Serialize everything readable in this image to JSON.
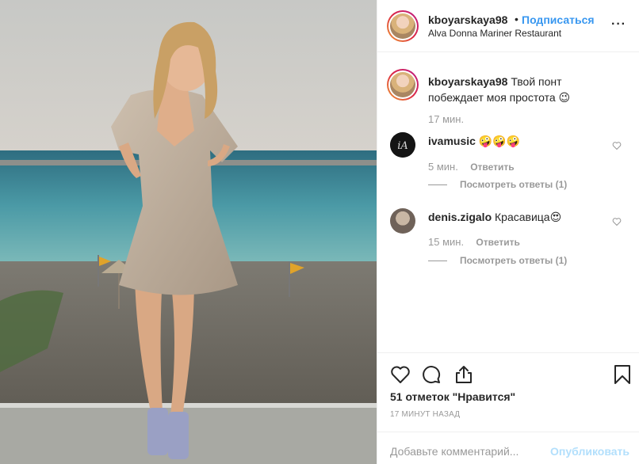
{
  "post": {
    "username": "kboyarskaya98",
    "dot": "•",
    "follow_label": "Подписаться",
    "location": "Alva Donna Mariner Restaurant",
    "more_label": "···"
  },
  "caption": {
    "username": "kboyarskaya98",
    "text": "Твой понт побеждает моя простота 😉",
    "time": "17 мин."
  },
  "comments": [
    {
      "username": "ivamusic",
      "text": "🤪🤪🤪",
      "time": "5 мин.",
      "reply_label": "Ответить",
      "view_replies": "Посмотреть ответы (1)"
    },
    {
      "username": "denis.zigalo",
      "text": "Красавица😍",
      "time": "15 мин.",
      "reply_label": "Ответить",
      "view_replies": "Посмотреть ответы (1)"
    }
  ],
  "actions": {
    "likes": "51 отметок \"Нравится\"",
    "post_time": "17 МИНУТ НАЗАД"
  },
  "add_comment": {
    "placeholder": "Добавьте комментарий...",
    "publish_label": "Опубликовать"
  },
  "icons": {
    "like": "heart-icon",
    "comment": "comment-icon",
    "share": "share-icon",
    "save": "bookmark-icon",
    "more": "more-options-icon"
  },
  "colors": {
    "accent": "#3897f0",
    "text": "#262626",
    "muted": "#999999",
    "publish_disabled": "#b2dffc"
  }
}
